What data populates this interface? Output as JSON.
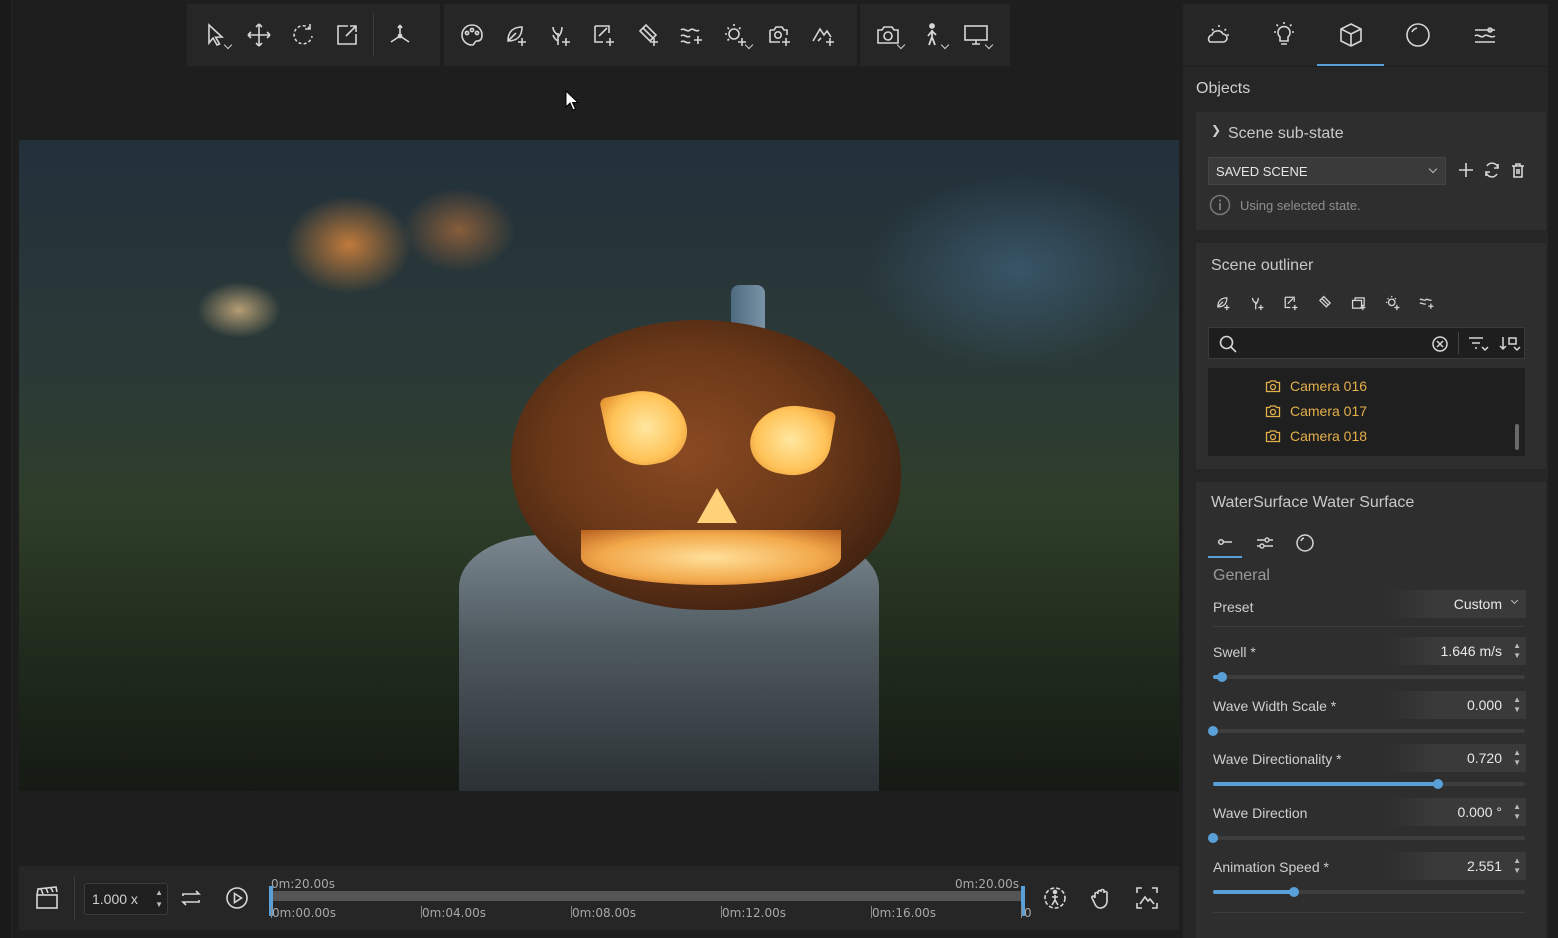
{
  "toolbar": {
    "groups": [
      [
        "select-icon",
        "move-icon",
        "rotate-icon",
        "scale-icon",
        "pivot-icon"
      ],
      [
        "materials-icon",
        "add-nature-icon",
        "add-plant-icon",
        "add-object-icon",
        "add-decal-icon",
        "add-water-icon",
        "add-light-icon",
        "add-camera-icon",
        "add-terrain-icon"
      ],
      [
        "camera-icon",
        "walk-icon",
        "screen-icon"
      ]
    ]
  },
  "timeline": {
    "speed": "1.000 x",
    "start_label": "0m:20.00s",
    "end_label": "0m:20.00s",
    "ticks": [
      "0m:00.00s",
      "0m:04.00s",
      "0m:08.00s",
      "0m:12.00s",
      "0m:16.00s",
      "0"
    ],
    "colors": {
      "handle": "#5aa0d8",
      "track": "#555555"
    }
  },
  "right_panel": {
    "tabs": [
      "weather-icon",
      "light-icon",
      "object-icon",
      "material-sphere-icon",
      "water-settings-icon"
    ],
    "active_tab": 2,
    "section_title": "Objects",
    "sub_state": {
      "title": "Scene sub-state",
      "selected": "SAVED SCENE",
      "info": "Using selected state."
    },
    "outliner": {
      "title": "Scene outliner",
      "search_placeholder": "",
      "items": [
        "Camera 016",
        "Camera 017",
        "Camera 018"
      ]
    },
    "properties": {
      "title": "WaterSurface Water Surface",
      "group": "General",
      "preset_label": "Preset",
      "preset_value": "Custom",
      "params": [
        {
          "label": "Swell *",
          "value": "1.646 m/s",
          "fraction": 0.03
        },
        {
          "label": "Wave Width Scale *",
          "value": "0.000",
          "fraction": 0.0
        },
        {
          "label": "Wave Directionality *",
          "value": "0.720",
          "fraction": 0.72
        },
        {
          "label": "Wave Direction",
          "value": "0.000 °",
          "fraction": 0.0
        },
        {
          "label": "Animation Speed *",
          "value": "2.551",
          "fraction": 0.26
        }
      ]
    },
    "colors": {
      "accent": "#5aa0d8",
      "outliner_item": "#e4b04a"
    }
  }
}
